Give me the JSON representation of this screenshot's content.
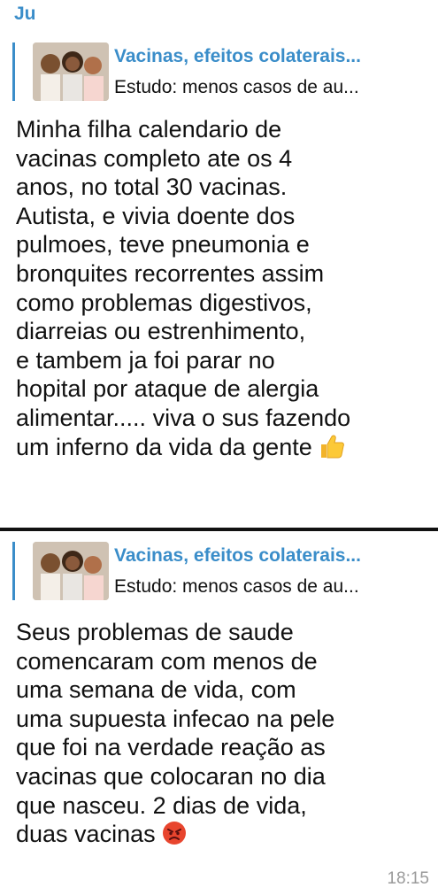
{
  "message1": {
    "sender": "Ju",
    "reply": {
      "title": "Vacinas, efeitos colaterais...",
      "text": "Estudo: menos casos de au..."
    },
    "body": "Minha filha calendario de\nvacinas completo ate os 4\nanos, no total 30 vacinas.\nAutista, e vivia doente dos\npulmoes, teve pneumonia e\nbronquites recorrentes  assim\ncomo problemas digestivos,\ndiarreias ou estrenhimento,\ne tambem ja foi parar no\nhopital por ataque de alergia\nalimentar..... viva o sus fazendo\num inferno da vida da gente",
    "emoji": "thumbs-up-icon"
  },
  "message2": {
    "reply": {
      "title": "Vacinas, efeitos colaterais...",
      "text": "Estudo: menos casos de au..."
    },
    "body": "Seus problemas de saude\ncomencaram com menos de\numa semana de vida, com\numa supuesta infecao na pele\nque foi na verdade reação as\nvacinas que colocaran no dia\nque nasceu. 2 dias de vida,\nduas vacinas",
    "emoji": "angry-face-icon",
    "time": "18:15"
  },
  "colors": {
    "accent": "#3a8dc9",
    "text": "#111111",
    "time": "#9a9a9a"
  }
}
